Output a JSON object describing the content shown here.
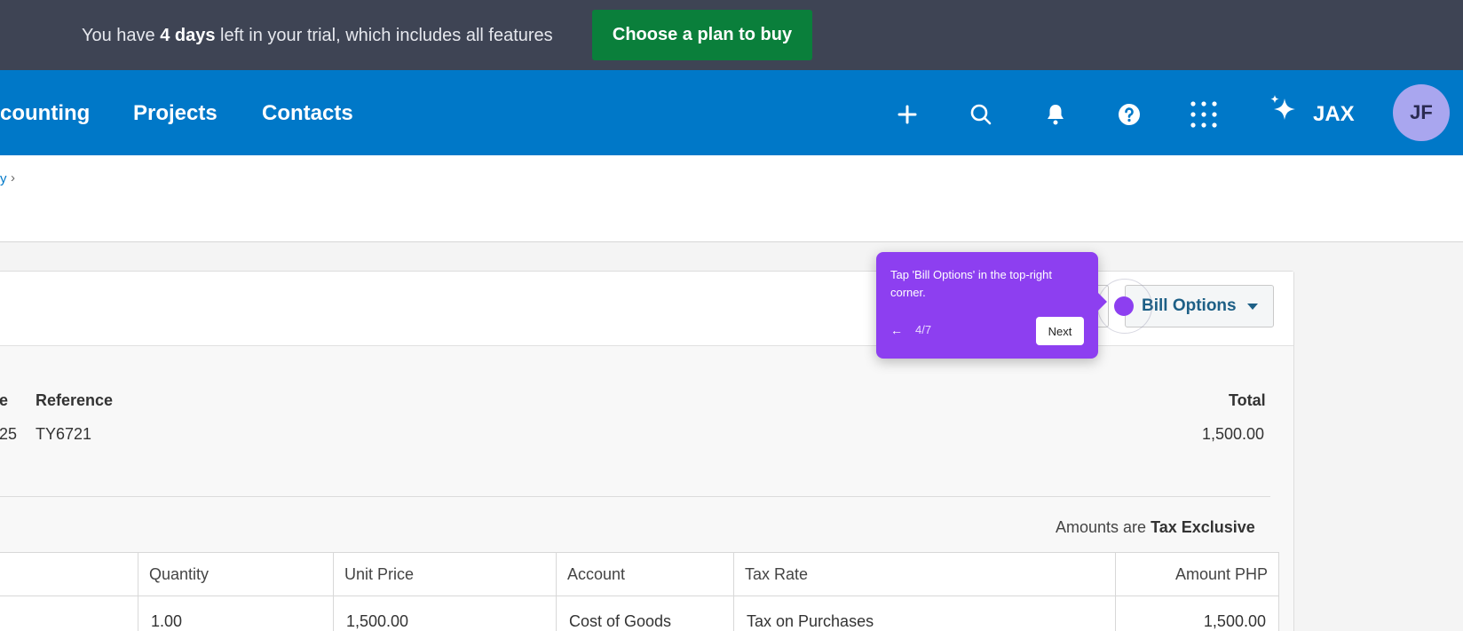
{
  "trial": {
    "prefix": "You have ",
    "days": "4 days",
    "suffix": " left in your trial, which includes all features",
    "cta": "Choose a plan to buy"
  },
  "nav": {
    "items": [
      "counting",
      "Projects",
      "Contacts"
    ],
    "jax_label": "JAX",
    "avatar_initials": "JF",
    "icons": [
      "plus-icon",
      "search-icon",
      "bell-icon",
      "help-icon",
      "apps-grid-icon",
      "sparkle-icon"
    ]
  },
  "breadcrumb": {
    "link": "y",
    "separator": "›"
  },
  "toolbar": {
    "bill_options_label": "Bill Options"
  },
  "summary": {
    "headers": {
      "partial": "e",
      "reference": "Reference",
      "total": "Total"
    },
    "values": {
      "partial": "25",
      "reference": "TY6721",
      "total": "1,500.00"
    }
  },
  "amounts": {
    "prefix": "Amounts are",
    "mode": "Tax Exclusive"
  },
  "table": {
    "columns": [
      "Quantity",
      "Unit Price",
      "Account",
      "Tax Rate",
      "Amount PHP"
    ],
    "rows": [
      {
        "quantity": "1.00",
        "unit_price": "1,500.00",
        "account": "Cost of Goods",
        "tax_rate": "Tax on Purchases",
        "amount": "1,500.00"
      }
    ]
  },
  "tour": {
    "message": "Tap 'Bill Options' in the top-right corner.",
    "back": "←",
    "step": "4/7",
    "next": "Next"
  },
  "colors": {
    "trial_bg": "#3e4454",
    "cta_green": "#0a7f3b",
    "nav_blue": "#0078c8",
    "avatar_bg": "#a9a6ef",
    "tour_purple": "#8d3ff0"
  }
}
